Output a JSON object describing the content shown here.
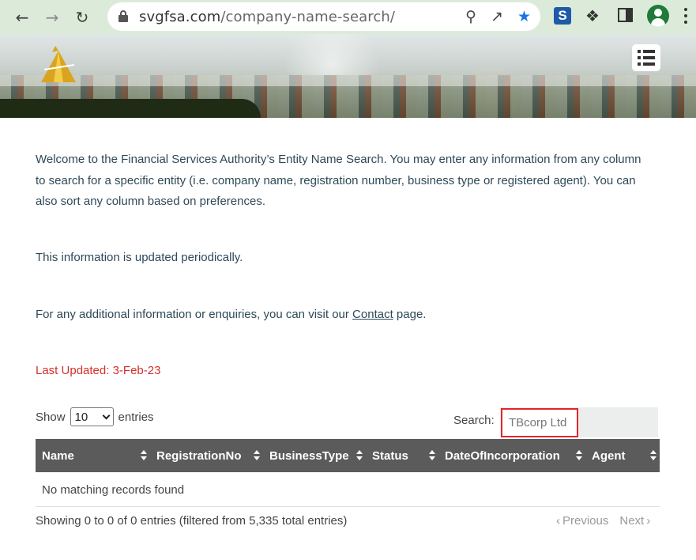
{
  "browser": {
    "url_host": "svgfsa.com",
    "url_path": "/company-name-search/",
    "extension_badge": "S"
  },
  "intro": {
    "paragraph1": "Welcome to the Financial Services Authority’s Entity Name Search. You may enter any information from any column to search for a specific entity (i.e. company name, registration number, business type or registered agent). You can also sort any column based on preferences.",
    "paragraph2": "This information is updated periodically.",
    "paragraph3_before": "For any additional information or enquiries, you can visit our ",
    "paragraph3_link": "Contact",
    "paragraph3_after": " page.",
    "last_updated": "Last Updated:  3-Feb-23"
  },
  "table": {
    "show_label": "Show",
    "entries_value": "10",
    "entries_label": "entries",
    "search_label": "Search:",
    "search_value": "TBcorp Ltd",
    "columns": [
      "Name",
      "RegistrationNo",
      "BusinessType",
      "Status",
      "DateOfIncorporation",
      "Agent"
    ],
    "empty_message": "No matching records found",
    "info": "Showing 0 to 0 of 0 entries (filtered from 5,335 total entries)",
    "prev_label": "Previous",
    "next_label": "Next"
  },
  "colors": {
    "header_bg": "#5b5b5b",
    "highlight": "#e3262b",
    "last_updated": "#d2302b",
    "body_text": "#2f4858"
  },
  "icons": [
    "back-icon",
    "forward-icon",
    "reload-icon",
    "lock-icon",
    "zoom-icon",
    "share-icon",
    "bookmark-star-icon",
    "extension-puzzle-icon",
    "side-panel-icon",
    "profile-avatar-icon",
    "kebab-menu-icon",
    "hamburger-menu-icon",
    "sort-icon"
  ]
}
